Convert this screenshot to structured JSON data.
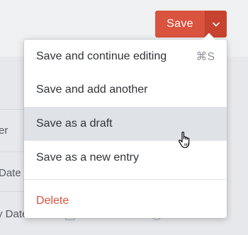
{
  "save_button": {
    "label": "Save",
    "toggle_icon": "chevron-down-icon"
  },
  "background": {
    "labels": [
      "er",
      "Date",
      "y Date"
    ]
  },
  "menu": {
    "items": [
      {
        "label": "Save and continue editing",
        "shortcut": "⌘S"
      },
      {
        "label": "Save and add another"
      },
      {
        "label": "Save as a draft"
      },
      {
        "label": "Save as a new entry"
      }
    ],
    "delete_label": "Delete",
    "active_index": 2
  },
  "colors": {
    "primary": "#d9533f",
    "primary_dark": "#c7432f",
    "hover": "#dfe3e8",
    "danger": "#d9533f"
  },
  "cursor_icon": "pointer-hand-icon"
}
